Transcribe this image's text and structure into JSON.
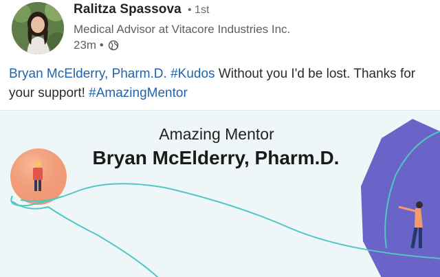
{
  "post": {
    "author_name": "Ralitza Spassova",
    "connection_degree": "• 1st",
    "author_title": "Medical Advisor at Vitacore Industries Inc.",
    "timestamp": "23m •",
    "visibility_icon": "globe-icon",
    "text": {
      "mention": "Bryan McElderry, Pharm.D.",
      "hashtag_kudos": "#Kudos",
      "body_part_1": " Without you I'd be lost. Thanks for your support! ",
      "hashtag_mentor": "#AmazingMentor"
    }
  },
  "kudos_card": {
    "subtitle": "Amazing Mentor",
    "recipient": "Bryan McElderry, Pharm.D."
  },
  "colors": {
    "link": "#1f63ad",
    "card_background": "#eef6f8",
    "accent_purple": "#6a63c8",
    "accent_teal": "#4fc7c3",
    "accent_orange": "#f19a76"
  }
}
